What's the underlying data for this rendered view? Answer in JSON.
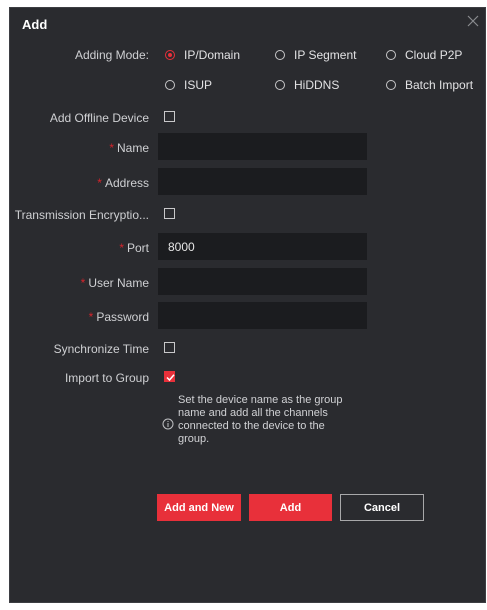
{
  "dialog": {
    "title": "Add"
  },
  "adding_mode": {
    "label": "Adding Mode:",
    "options": [
      "IP/Domain",
      "IP Segment",
      "Cloud P2P",
      "ISUP",
      "HiDDNS",
      "Batch Import"
    ],
    "selected": "IP/Domain"
  },
  "fields": {
    "add_offline_device": {
      "label": "Add Offline Device",
      "checked": false
    },
    "name": {
      "label": "Name",
      "required": true,
      "value": ""
    },
    "address": {
      "label": "Address",
      "required": true,
      "value": ""
    },
    "transmission_encryption": {
      "label": "Transmission Encryptio...",
      "checked": false
    },
    "port": {
      "label": "Port",
      "required": true,
      "value": "8000"
    },
    "user_name": {
      "label": "User Name",
      "required": true,
      "value": ""
    },
    "password": {
      "label": "Password",
      "required": true,
      "value": ""
    },
    "synchronize_time": {
      "label": "Synchronize Time",
      "checked": false
    },
    "import_to_group": {
      "label": "Import to Group",
      "checked": true
    }
  },
  "tip": "Set the device name as the group name and add all the channels connected to the device to the group.",
  "buttons": {
    "add_and_new": "Add and New",
    "add": "Add",
    "cancel": "Cancel"
  },
  "icons": {
    "close": "close-icon",
    "info": "info-icon",
    "check": "checkmark-icon"
  },
  "colors": {
    "accent": "#e8303a",
    "background": "#2a2b2f",
    "field": "#1b1c1f"
  }
}
